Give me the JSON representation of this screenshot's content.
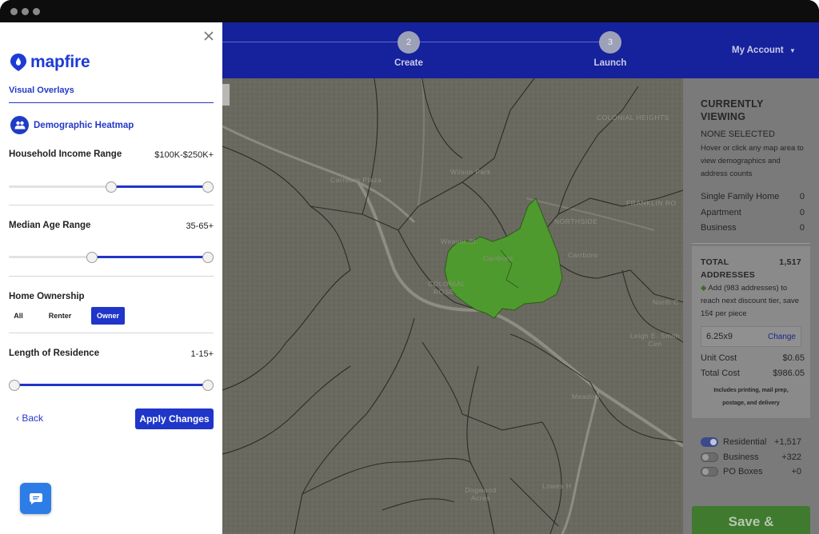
{
  "panel": {
    "brand": "mapfire",
    "section_title": "Visual Overlays",
    "overlay_title": "Demographic Heatmap",
    "filters": {
      "income": {
        "label": "Household Income Range",
        "value": "$100K-$250K+",
        "low": 0.5,
        "high": 1.0
      },
      "age": {
        "label": "Median Age Range",
        "value": "35-65+",
        "low": 0.4,
        "high": 1.0
      },
      "ownership": {
        "label": "Home Ownership",
        "options": [
          "All",
          "Renter",
          "Owner"
        ],
        "selected": "Owner"
      },
      "residence": {
        "label": "Length of Residence",
        "value": "1-15+",
        "low": 0.0,
        "high": 1.0
      }
    },
    "back_label": "Back",
    "apply_label": "Apply Changes"
  },
  "nav": {
    "steps": [
      {
        "number": "2",
        "label": "Create"
      },
      {
        "number": "3",
        "label": "Launch"
      }
    ],
    "account_label": "My Account"
  },
  "map": {
    "labels": [
      "COLONIAL HEIGHTS",
      "Wilson Park",
      "NORTHSIDE",
      "FRANKLIN RO",
      "Weaver St",
      "Carrboro",
      "Carrboro",
      "COLONIAL ROSE",
      "North C",
      "Meadow",
      "Dogwood Acres",
      "Lowes H",
      "Carrboro Plaza",
      "Leigh E. Smith Cen"
    ],
    "highlight_color": "#4f9a2e"
  },
  "summary": {
    "heading": "CURRENTLY VIEWING",
    "selection": "NONE SELECTED",
    "hint": "Hover or click any map area to view demographics and address counts",
    "rows": [
      {
        "label": "Single Family Home",
        "value": "0"
      },
      {
        "label": "Apartment",
        "value": "0"
      },
      {
        "label": "Business",
        "value": "0"
      }
    ],
    "total_label": "TOTAL ADDRESSES",
    "total_value": "1,517",
    "discount_note": "Add (983 addresses) to reach next discount tier, save 15¢ per piece",
    "size": "6.25x9",
    "change_label": "Change",
    "unit_cost_label": "Unit Cost",
    "unit_cost": "$0.65",
    "total_cost_label": "Total Cost",
    "total_cost": "$986.05",
    "includes_note": "Includes printing, mail prep, postage, and delivery",
    "toggles": [
      {
        "label": "Residential",
        "count": "+1,517",
        "on": true
      },
      {
        "label": "Business",
        "count": "+322",
        "on": false
      },
      {
        "label": "PO Boxes",
        "count": "+0",
        "on": false
      }
    ],
    "save_label": "Save &"
  }
}
